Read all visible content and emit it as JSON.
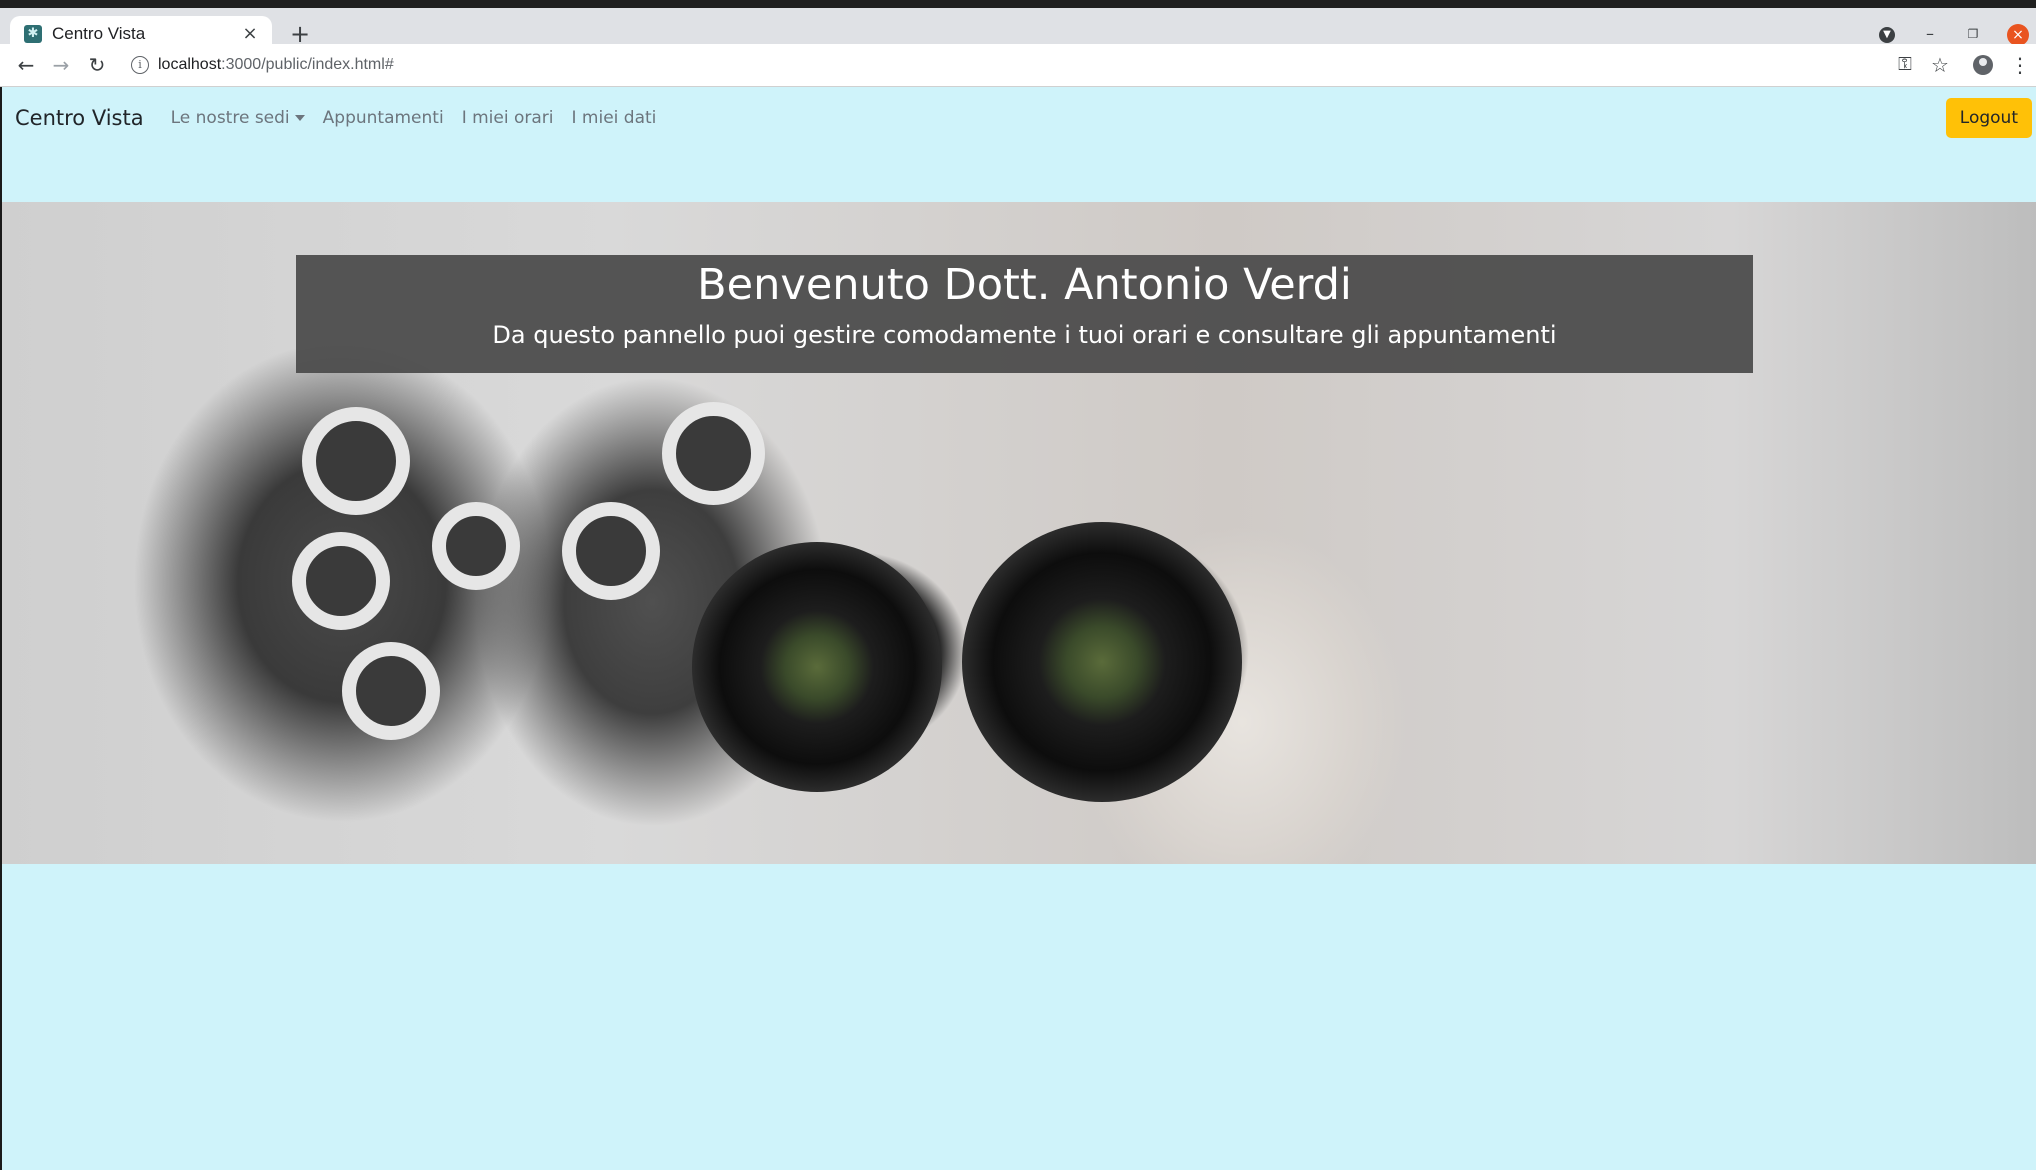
{
  "browser": {
    "tab_title": "Centro Vista",
    "tab_close": "×",
    "new_tab": "+",
    "url_host": "localhost",
    "url_path": ":3000/public/index.html#"
  },
  "navbar": {
    "brand": "Centro Vista",
    "links": [
      "Le nostre sedi",
      "Appuntamenti",
      "I miei orari",
      "I miei dati"
    ],
    "logout": "Logout"
  },
  "hero": {
    "title": "Benvenuto Dott. Antonio Verdi",
    "subtitle": "Da questo pannello puoi gestire comodamente i tuoi orari e consultare gli appuntamenti"
  },
  "colors": {
    "page_background": "#cff3fa",
    "logout_button": "#ffc107",
    "hero_banner": "#4b4b4b"
  },
  "icons": {
    "back": "arrow-left-icon",
    "forward": "arrow-right-icon",
    "reload": "reload-icon",
    "info": "info-icon",
    "key": "key-icon",
    "star": "star-icon",
    "profile": "profile-icon",
    "menu": "kebab-menu-icon"
  }
}
